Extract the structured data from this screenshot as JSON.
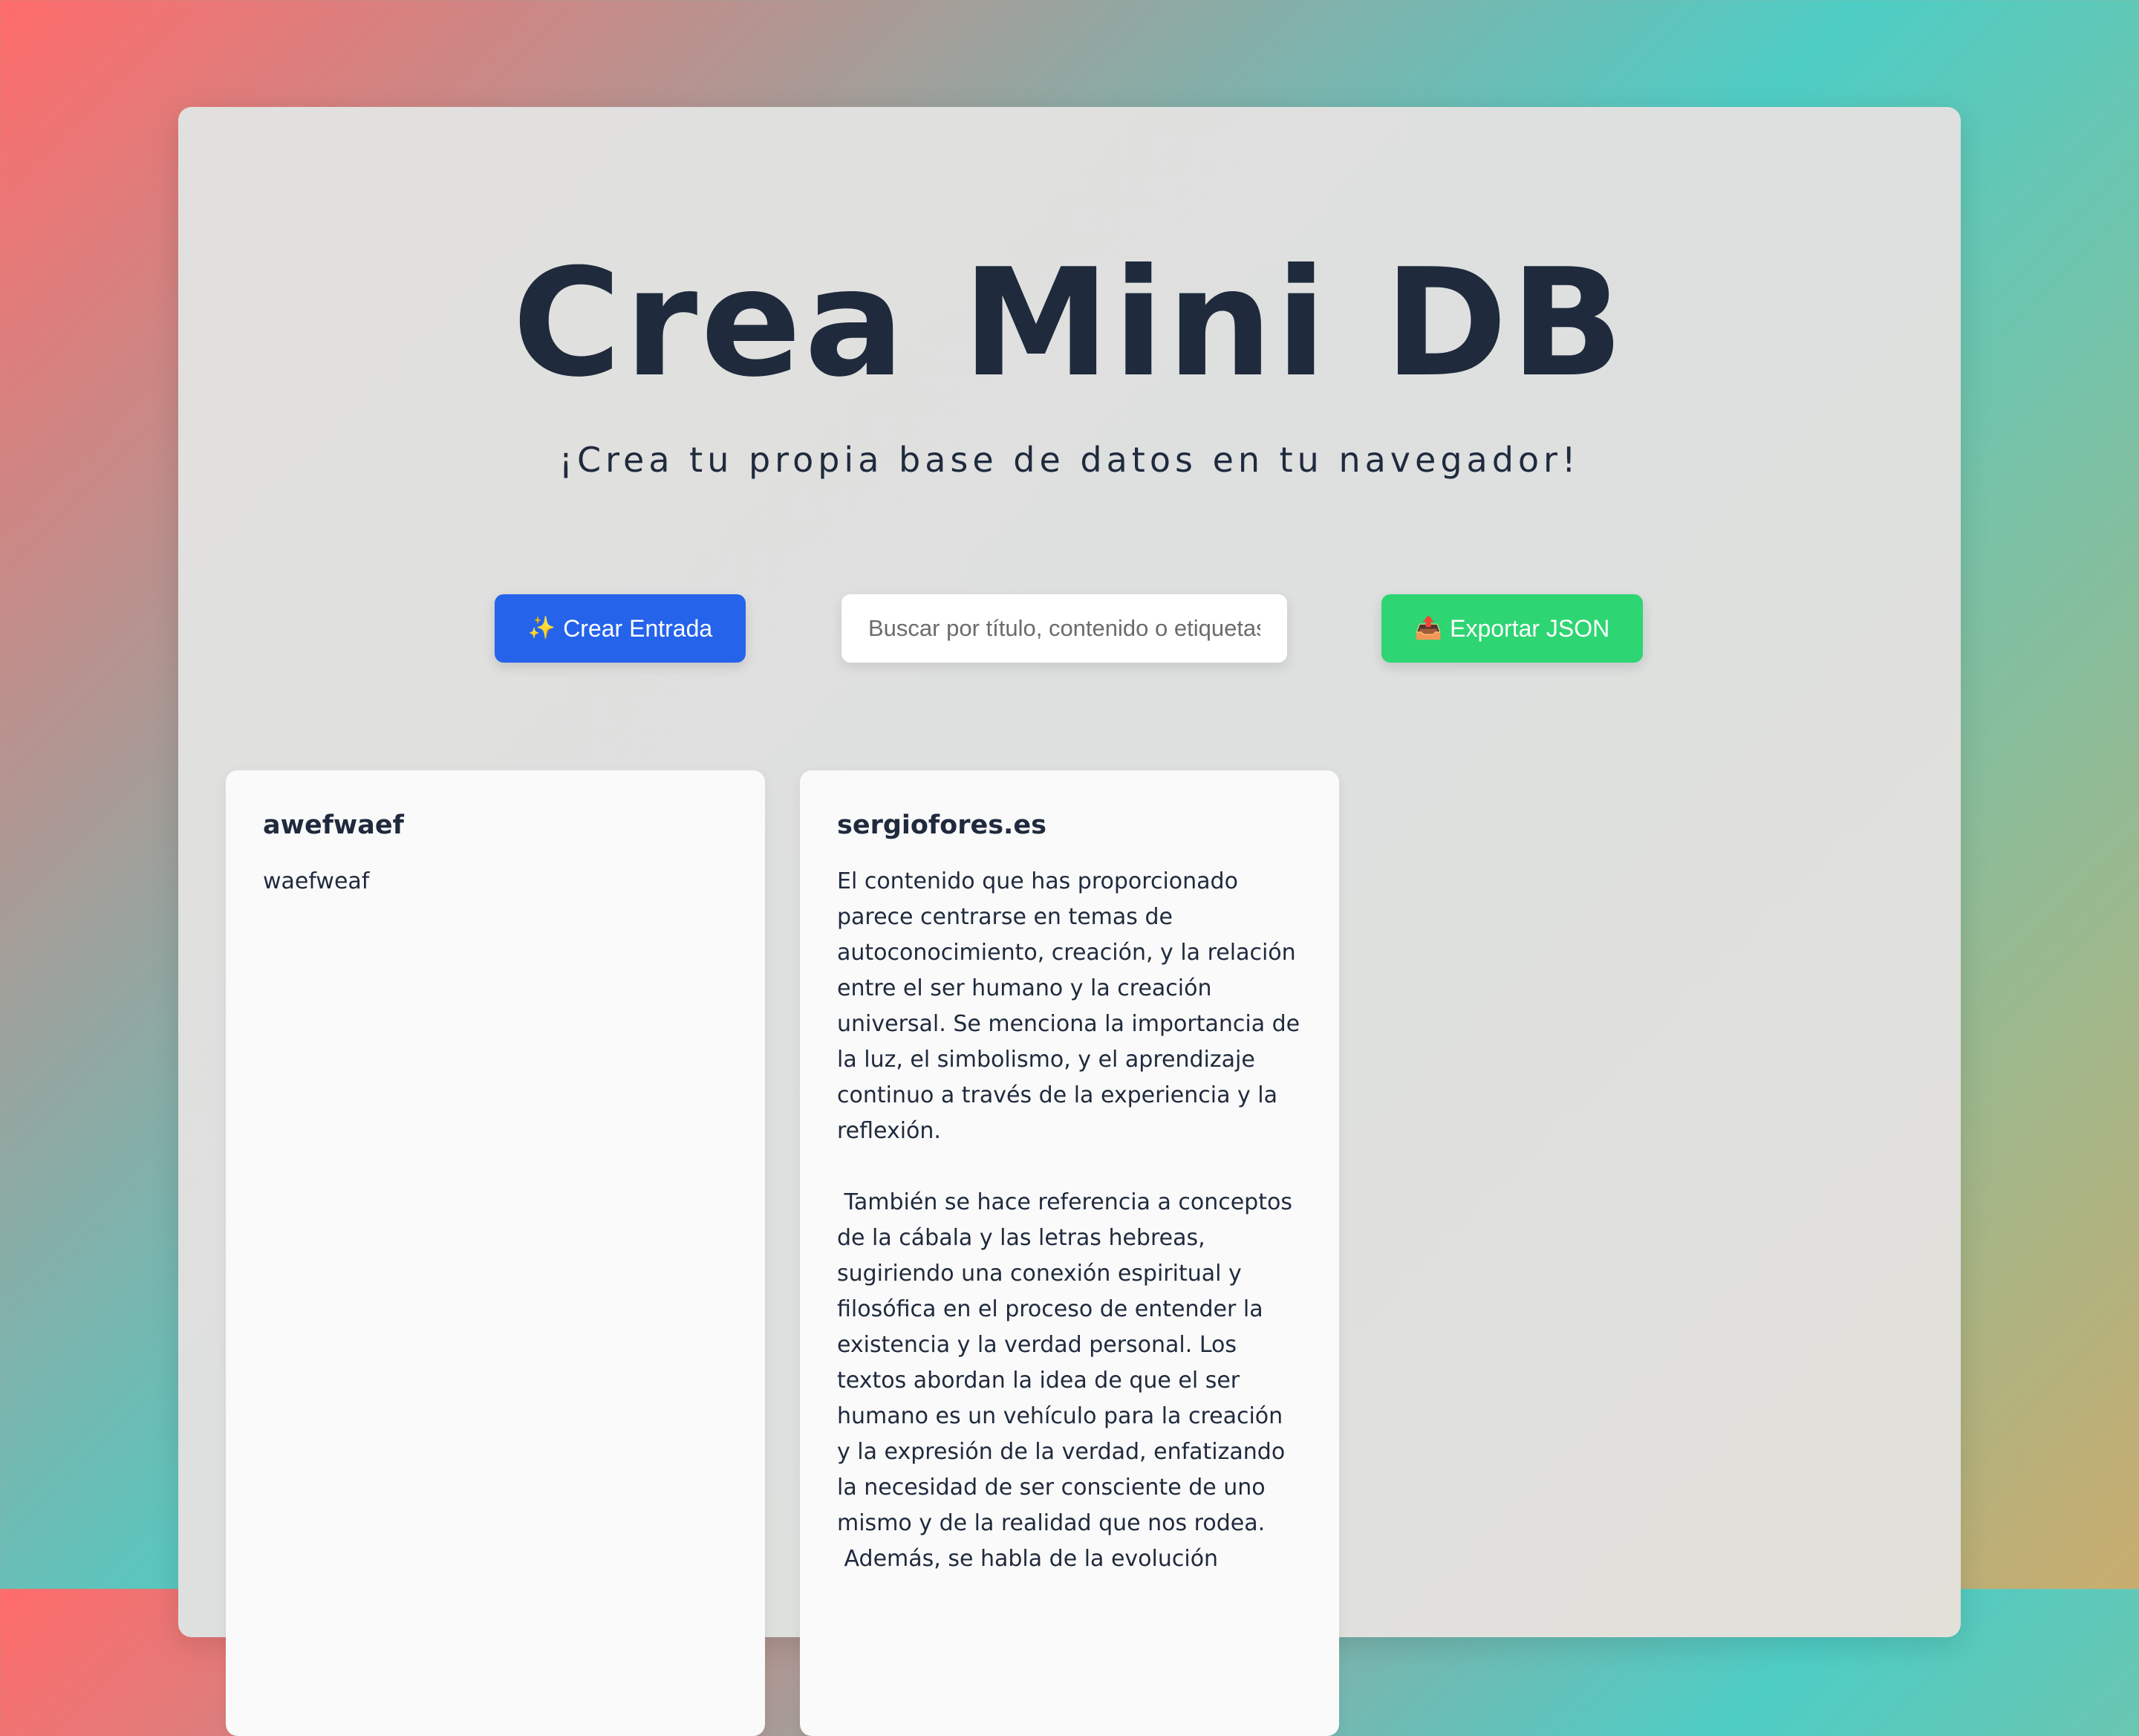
{
  "header": {
    "title": "Crea Mini DB",
    "subtitle": "¡Crea tu propia base de datos en tu navegador!"
  },
  "toolbar": {
    "create_icon": "✨",
    "create_label": "Crear Entrada",
    "search_placeholder": "Buscar por título, contenido o etiquetas...",
    "export_icon": "📤",
    "export_label": "Exportar JSON"
  },
  "entries": [
    {
      "title": "awefwaef",
      "content": "waefweaf"
    },
    {
      "title": "sergiofores.es",
      "content": "El contenido que has proporcionado parece centrarse en temas de autoconocimiento, creación, y la relación entre el ser humano y la creación universal. Se menciona la importancia de la luz, el simbolismo, y el aprendizaje continuo a través de la experiencia y la reflexión.\n\n También se hace referencia a conceptos de la cábala y las letras hebreas, sugiriendo una conexión espiritual y filosófica en el proceso de entender la existencia y la verdad personal. Los textos abordan la idea de que el ser humano es un vehículo para la creación y la expresión de la verdad, enfatizando la necesidad de ser consciente de uno mismo y de la realidad que nos rodea.\n Además, se habla de la evolución"
    }
  ]
}
